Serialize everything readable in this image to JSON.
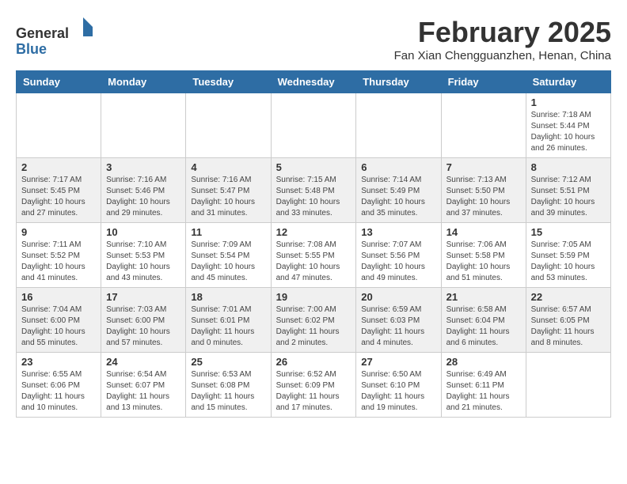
{
  "header": {
    "logo_line1": "General",
    "logo_line2": "Blue",
    "month_year": "February 2025",
    "location": "Fan Xian Chengguanzhen, Henan, China"
  },
  "weekdays": [
    "Sunday",
    "Monday",
    "Tuesday",
    "Wednesday",
    "Thursday",
    "Friday",
    "Saturday"
  ],
  "weeks": [
    [
      {
        "day": "",
        "info": ""
      },
      {
        "day": "",
        "info": ""
      },
      {
        "day": "",
        "info": ""
      },
      {
        "day": "",
        "info": ""
      },
      {
        "day": "",
        "info": ""
      },
      {
        "day": "",
        "info": ""
      },
      {
        "day": "1",
        "info": "Sunrise: 7:18 AM\nSunset: 5:44 PM\nDaylight: 10 hours and 26 minutes."
      }
    ],
    [
      {
        "day": "2",
        "info": "Sunrise: 7:17 AM\nSunset: 5:45 PM\nDaylight: 10 hours and 27 minutes."
      },
      {
        "day": "3",
        "info": "Sunrise: 7:16 AM\nSunset: 5:46 PM\nDaylight: 10 hours and 29 minutes."
      },
      {
        "day": "4",
        "info": "Sunrise: 7:16 AM\nSunset: 5:47 PM\nDaylight: 10 hours and 31 minutes."
      },
      {
        "day": "5",
        "info": "Sunrise: 7:15 AM\nSunset: 5:48 PM\nDaylight: 10 hours and 33 minutes."
      },
      {
        "day": "6",
        "info": "Sunrise: 7:14 AM\nSunset: 5:49 PM\nDaylight: 10 hours and 35 minutes."
      },
      {
        "day": "7",
        "info": "Sunrise: 7:13 AM\nSunset: 5:50 PM\nDaylight: 10 hours and 37 minutes."
      },
      {
        "day": "8",
        "info": "Sunrise: 7:12 AM\nSunset: 5:51 PM\nDaylight: 10 hours and 39 minutes."
      }
    ],
    [
      {
        "day": "9",
        "info": "Sunrise: 7:11 AM\nSunset: 5:52 PM\nDaylight: 10 hours and 41 minutes."
      },
      {
        "day": "10",
        "info": "Sunrise: 7:10 AM\nSunset: 5:53 PM\nDaylight: 10 hours and 43 minutes."
      },
      {
        "day": "11",
        "info": "Sunrise: 7:09 AM\nSunset: 5:54 PM\nDaylight: 10 hours and 45 minutes."
      },
      {
        "day": "12",
        "info": "Sunrise: 7:08 AM\nSunset: 5:55 PM\nDaylight: 10 hours and 47 minutes."
      },
      {
        "day": "13",
        "info": "Sunrise: 7:07 AM\nSunset: 5:56 PM\nDaylight: 10 hours and 49 minutes."
      },
      {
        "day": "14",
        "info": "Sunrise: 7:06 AM\nSunset: 5:58 PM\nDaylight: 10 hours and 51 minutes."
      },
      {
        "day": "15",
        "info": "Sunrise: 7:05 AM\nSunset: 5:59 PM\nDaylight: 10 hours and 53 minutes."
      }
    ],
    [
      {
        "day": "16",
        "info": "Sunrise: 7:04 AM\nSunset: 6:00 PM\nDaylight: 10 hours and 55 minutes."
      },
      {
        "day": "17",
        "info": "Sunrise: 7:03 AM\nSunset: 6:00 PM\nDaylight: 10 hours and 57 minutes."
      },
      {
        "day": "18",
        "info": "Sunrise: 7:01 AM\nSunset: 6:01 PM\nDaylight: 11 hours and 0 minutes."
      },
      {
        "day": "19",
        "info": "Sunrise: 7:00 AM\nSunset: 6:02 PM\nDaylight: 11 hours and 2 minutes."
      },
      {
        "day": "20",
        "info": "Sunrise: 6:59 AM\nSunset: 6:03 PM\nDaylight: 11 hours and 4 minutes."
      },
      {
        "day": "21",
        "info": "Sunrise: 6:58 AM\nSunset: 6:04 PM\nDaylight: 11 hours and 6 minutes."
      },
      {
        "day": "22",
        "info": "Sunrise: 6:57 AM\nSunset: 6:05 PM\nDaylight: 11 hours and 8 minutes."
      }
    ],
    [
      {
        "day": "23",
        "info": "Sunrise: 6:55 AM\nSunset: 6:06 PM\nDaylight: 11 hours and 10 minutes."
      },
      {
        "day": "24",
        "info": "Sunrise: 6:54 AM\nSunset: 6:07 PM\nDaylight: 11 hours and 13 minutes."
      },
      {
        "day": "25",
        "info": "Sunrise: 6:53 AM\nSunset: 6:08 PM\nDaylight: 11 hours and 15 minutes."
      },
      {
        "day": "26",
        "info": "Sunrise: 6:52 AM\nSunset: 6:09 PM\nDaylight: 11 hours and 17 minutes."
      },
      {
        "day": "27",
        "info": "Sunrise: 6:50 AM\nSunset: 6:10 PM\nDaylight: 11 hours and 19 minutes."
      },
      {
        "day": "28",
        "info": "Sunrise: 6:49 AM\nSunset: 6:11 PM\nDaylight: 11 hours and 21 minutes."
      },
      {
        "day": "",
        "info": ""
      }
    ]
  ]
}
